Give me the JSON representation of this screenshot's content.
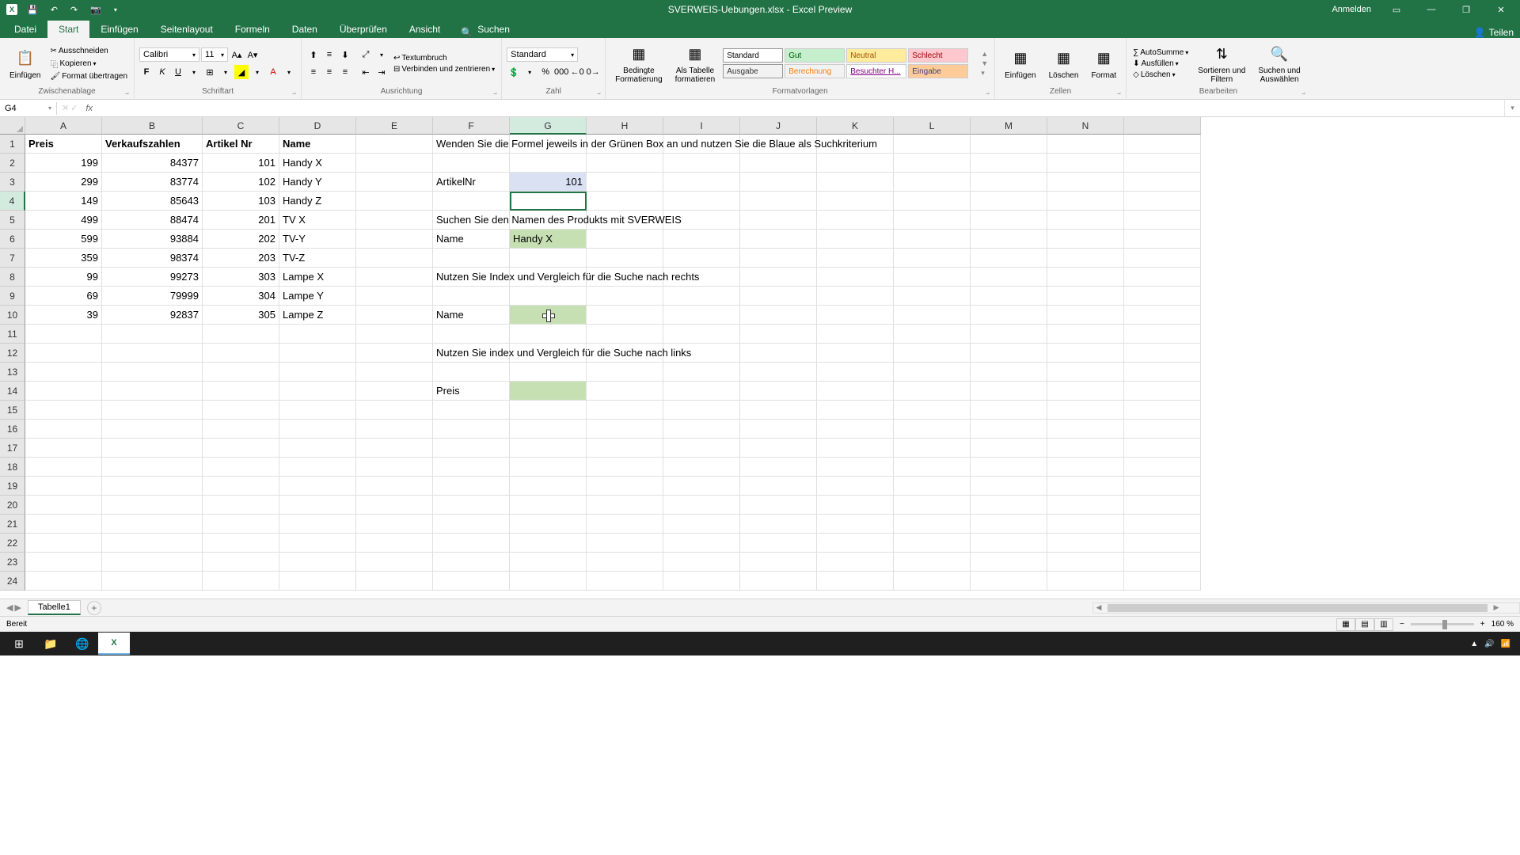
{
  "titlebar": {
    "title": "SVERWEIS-Uebungen.xlsx - Excel Preview",
    "signin": "Anmelden"
  },
  "ribbon_tabs": {
    "datei": "Datei",
    "start": "Start",
    "einfuegen": "Einfügen",
    "seitenlayout": "Seitenlayout",
    "formeln": "Formeln",
    "daten": "Daten",
    "ueberpruefen": "Überprüfen",
    "ansicht": "Ansicht",
    "suchen": "Suchen",
    "teilen": "Teilen"
  },
  "ribbon": {
    "clipboard": {
      "einfuegen": "Einfügen",
      "ausschneiden": "Ausschneiden",
      "kopieren": "Kopieren",
      "format": "Format übertragen",
      "label": "Zwischenablage"
    },
    "font": {
      "name": "Calibri",
      "size": "11",
      "label": "Schriftart"
    },
    "alignment": {
      "wrap": "Textumbruch",
      "merge": "Verbinden und zentrieren",
      "label": "Ausrichtung"
    },
    "number": {
      "format": "Standard",
      "label": "Zahl"
    },
    "styles": {
      "conditional": "Bedingte\nFormatierung",
      "as_table": "Als Tabelle\nformatieren",
      "standard": "Standard",
      "gut": "Gut",
      "neutral": "Neutral",
      "schlecht": "Schlecht",
      "ausgabe": "Ausgabe",
      "berechnung": "Berechnung",
      "besucht": "Besuchter H...",
      "eingabe": "Eingabe",
      "label": "Formatvorlagen"
    },
    "cells": {
      "einfuegen": "Einfügen",
      "loeschen": "Löschen",
      "format": "Format",
      "label": "Zellen"
    },
    "editing": {
      "autosumme": "AutoSumme",
      "ausfuellen": "Ausfüllen",
      "loeschen": "Löschen",
      "sortieren": "Sortieren und\nFiltern",
      "suchen": "Suchen und\nAuswählen",
      "label": "Bearbeiten"
    }
  },
  "namebox": "G4",
  "columns": [
    "A",
    "B",
    "C",
    "D",
    "E",
    "F",
    "G",
    "H",
    "I",
    "J",
    "K",
    "L",
    "M",
    "N"
  ],
  "rows": {
    "1": {
      "A": "Preis",
      "B": "Verkaufszahlen",
      "C": "Artikel Nr",
      "D": "Name",
      "F": "Wenden Sie die Formel jeweils in der Grünen Box an und nutzen Sie die Blaue als Suchkriterium"
    },
    "2": {
      "A": "199",
      "B": "84377",
      "C": "101",
      "D": "Handy X"
    },
    "3": {
      "A": "299",
      "B": "83774",
      "C": "102",
      "D": "Handy Y",
      "F": "ArtikelNr",
      "G": "101"
    },
    "4": {
      "A": "149",
      "B": "85643",
      "C": "103",
      "D": "Handy Z"
    },
    "5": {
      "A": "499",
      "B": "88474",
      "C": "201",
      "D": "TV X",
      "F": "Suchen Sie den Namen des Produkts mit SVERWEIS"
    },
    "6": {
      "A": "599",
      "B": "93884",
      "C": "202",
      "D": "TV-Y",
      "F": "Name",
      "G": "Handy X"
    },
    "7": {
      "A": "359",
      "B": "98374",
      "C": "203",
      "D": "TV-Z"
    },
    "8": {
      "A": "99",
      "B": "99273",
      "C": "303",
      "D": "Lampe X",
      "F": "Nutzen Sie Index und Vergleich für die Suche nach rechts"
    },
    "9": {
      "A": "69",
      "B": "79999",
      "C": "304",
      "D": "Lampe Y"
    },
    "10": {
      "A": "39",
      "B": "92837",
      "C": "305",
      "D": "Lampe Z",
      "F": "Name"
    },
    "12": {
      "F": "Nutzen Sie index und Vergleich für die Suche nach links"
    },
    "14": {
      "F": "Preis"
    }
  },
  "sheet_tab": "Tabelle1",
  "status": {
    "ready": "Bereit",
    "zoom": "160 %"
  }
}
